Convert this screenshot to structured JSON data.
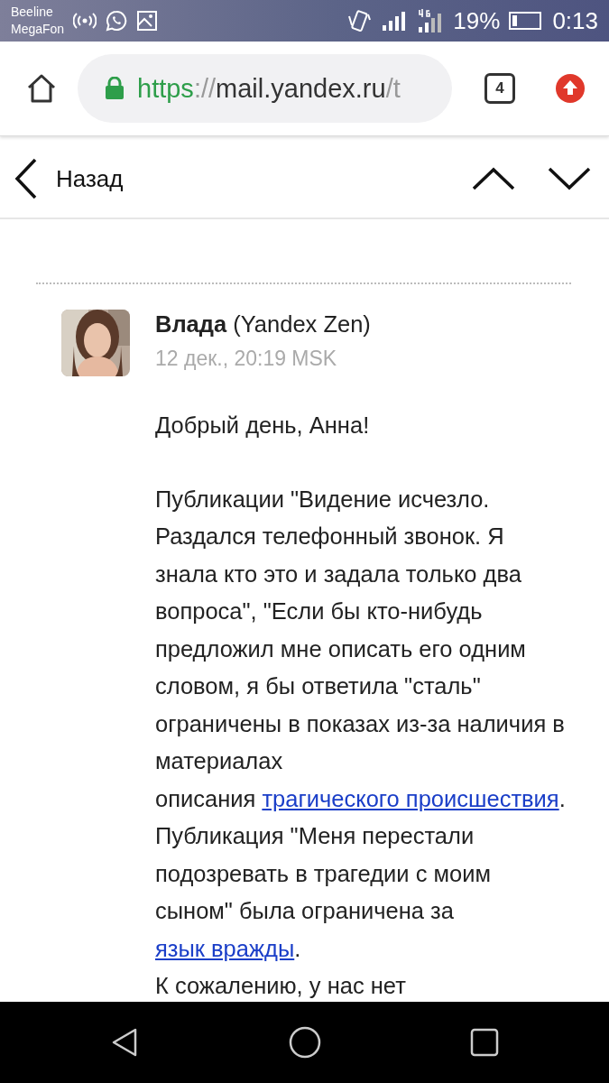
{
  "status_bar": {
    "carriers": [
      "Beeline",
      "MegaFon"
    ],
    "battery": "19%",
    "time": "0:13"
  },
  "browser": {
    "url": [
      {
        "kind": "scheme",
        "text": "https"
      },
      {
        "kind": "dim",
        "text": "://"
      },
      {
        "kind": "host",
        "text": "mail.yandex.ru"
      },
      {
        "kind": "dim",
        "text": "/t"
      }
    ],
    "tab_count": "4"
  },
  "header": {
    "back": "Назад"
  },
  "message": {
    "sender": "**Влада** (Yandex Zen)",
    "date": "12 дек., 20:19 MSK",
    "paragraphs": [
      [
        [
          {
            "kind": "text",
            "text": "Добрый день, Анна!"
          }
        ]
      ],
      [
        [
          {
            "kind": "text",
            "text": "Публикации \"Видение исчезло. Раздался телефонный звонок. Я знала кто это и задала только два вопроса\", \"Если бы кто-нибудь предложил мне описать его одним словом, я бы ответила \"сталь\" ограничены в показах из-за наличия в материалах"
          }
        ],
        [
          {
            "kind": "text",
            "text": "описания "
          },
          {
            "kind": "link",
            "text": "трагического происшествия"
          },
          {
            "kind": "text",
            "text": ". Публикация \"Меня перестали подозревать в трагедии с моим сыном\" была ограничена за "
          },
          {
            "kind": "link",
            "text": "язык вражды"
          },
          {
            "kind": "text",
            "text": "."
          }
        ],
        [
          {
            "kind": "text",
            "text": "К сожалению, у нас нет"
          }
        ]
      ]
    ]
  }
}
